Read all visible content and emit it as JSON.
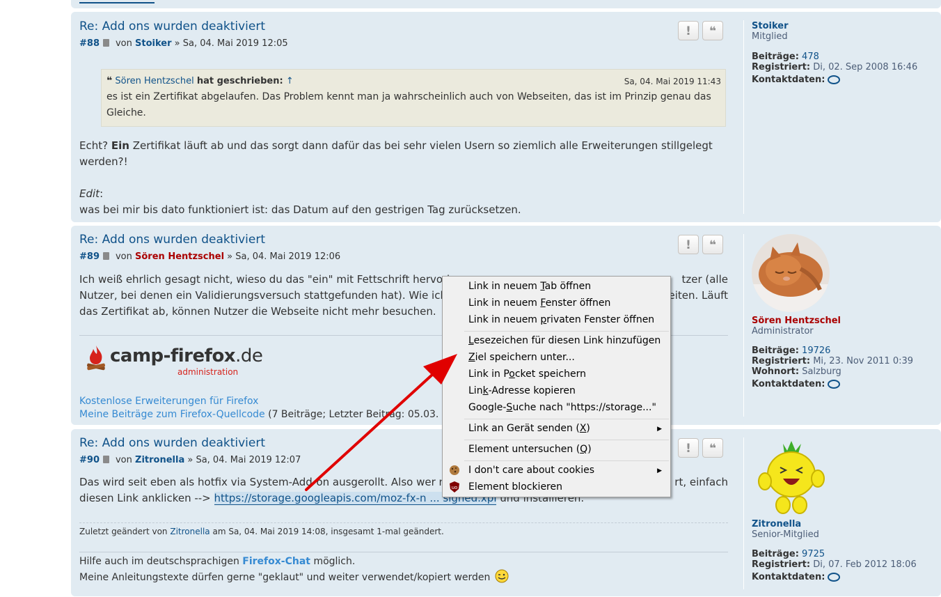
{
  "post88": {
    "title": "Re: Add ons wurden deaktiviert",
    "number": "#88",
    "von": "von",
    "author": "Stoiker",
    "date": "» Sa, 04. Mai 2019 12:05",
    "report_glyph": "!",
    "quote_glyph": "❝",
    "quote": {
      "author": "Sören Hentzschel",
      "wrote": "hat geschrieben:",
      "up": "↑",
      "date": "Sa, 04. Mai 2019 11:43",
      "line1": "es ist ein Zertifikat abgelaufen. Das Problem kennt man ja wahrscheinlich auch von Webseiten, das ist im Prinzip genau das",
      "line2": "Gleiche."
    },
    "text1a": "Echt?",
    "text1b": "Ein",
    "text1c": "Zertifikat läuft ab und das sorgt dann dafür das bei sehr vielen Usern so ziemlich alle Erweiterungen stillgelegt",
    "text1d": "werden?!",
    "edit_label": "Edit",
    "edit_colon": ":",
    "edit_text": "was bei mir bis dato funktioniert ist: das Datum auf den gestrigen Tag zurücksetzen.",
    "profile": {
      "name": "Stoiker",
      "rank": "Mitglied",
      "posts_label": "Beiträge:",
      "posts": "478",
      "reg_label": "Registriert:",
      "reg": "Di, 02. Sep 2008 16:46",
      "contact_label": "Kontaktdaten:"
    }
  },
  "post89": {
    "title": "Re: Add ons wurden deaktiviert",
    "number": "#89",
    "von": "von",
    "author": "Sören Hentzschel",
    "date": "» Sa, 04. Mai 2019 12:06",
    "line1a": "Ich weiß ehrlich gesagt nicht, wieso du das \"ein\" mit Fettschrift hervorh",
    "line1b": "tzer (alle",
    "line2a": "Nutzer, bei denen ein Validierungsversuch stattgefunden hat). Wie ich s",
    "line2b": "eiten. Läuft",
    "line3": "das Zertifikat ab, können Nutzer die Webseite nicht mehr besuchen.",
    "logo_main": "camp-firefox",
    "logo_tld": ".de",
    "logo_sub": "administration",
    "sig_link1": "Kostenlose Erweiterungen für Firefox",
    "sig_link2": "Meine Beiträge zum Firefox-Quellcode",
    "sig_rest": "(7 Beiträge; Letzter Beitrag: 05.03.",
    "profile": {
      "name": "Sören Hentzschel",
      "rank": "Administrator",
      "posts_label": "Beiträge:",
      "posts": "19726",
      "reg_label": "Registriert:",
      "reg": "Mi, 23. Nov 2011 0:39",
      "loc_label": "Wohnort:",
      "loc": "Salzburg",
      "contact_label": "Kontaktdaten:"
    }
  },
  "post90": {
    "title": "Re: Add ons wurden deaktiviert",
    "number": "#90",
    "von": "von",
    "author": "Zitronella",
    "date": "» Sa, 04. Mai 2019 12:07",
    "line1a": "Das wird seit eben als hotfix via System-Add-",
    "line1b": "on ausgerollt. Also wer nic",
    "line1c": "rt, einfach",
    "line2a": "diesen Link anklicken -->",
    "link": "https://storage.googleapis.com/moz-fx-n ... signed.xpi",
    "line2b": "und installieren.",
    "edited_prefix": "Zuletzt geändert von",
    "edited_user": "Zitronella",
    "edited_rest": "am Sa, 04. Mai 2019 14:08, insgesamt 1-mal geändert.",
    "sig1a": "Hilfe auch im deutschsprachigen",
    "sig1link": "Firefox-Chat",
    "sig1b": "möglich.",
    "sig2": "Meine Anleitungstexte dürfen gerne \"geklaut\" und weiter verwendet/kopiert werden",
    "profile": {
      "name": "Zitronella",
      "rank": "Senior-Mitglied",
      "posts_label": "Beiträge:",
      "posts": "9725",
      "reg_label": "Registriert:",
      "reg": "Di, 07. Feb 2012 18:06",
      "contact_label": "Kontaktdaten:"
    }
  },
  "context_menu": {
    "items": [
      {
        "pre": "Link in neuem ",
        "key": "T",
        "post": "ab öffnen"
      },
      {
        "pre": "Link in neuem ",
        "key": "F",
        "post": "enster öffnen"
      },
      {
        "pre": "Link in neuem ",
        "key": "p",
        "post": "rivaten Fenster öffnen"
      },
      {
        "pre": "",
        "key": "L",
        "post": "esezeichen für diesen Link hinzufügen"
      },
      {
        "pre": "",
        "key": "Z",
        "post": "iel speichern unter..."
      },
      {
        "pre": "Link in P",
        "key": "o",
        "post": "cket speichern"
      },
      {
        "pre": "Lin",
        "key": "k",
        "post": "-Adresse kopieren"
      },
      {
        "pre": "Google-",
        "key": "S",
        "post": "uche nach \"https://storage...\""
      },
      {
        "pre": "Link an Gerät senden (",
        "key": "X",
        "post": ")"
      },
      {
        "pre": "Element untersuchen (",
        "key": "Q",
        "post": ")"
      },
      {
        "pre": "I don't care about cookies",
        "key": "",
        "post": ""
      },
      {
        "pre": "Element blockieren",
        "key": "",
        "post": ""
      }
    ],
    "submenu_arrow": "▶",
    "ublock_label": "uo"
  },
  "colors": {
    "post_bg": "#e1ebf2",
    "link": "#105289",
    "admin": "#aa0000",
    "annotation_arrow": "#e00000"
  }
}
